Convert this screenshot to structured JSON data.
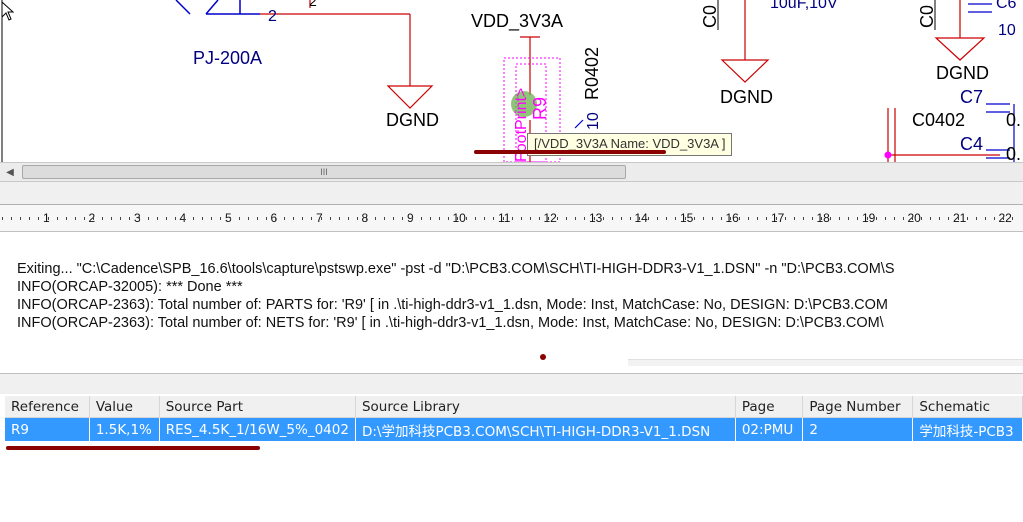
{
  "schematic": {
    "conn_pin": "2",
    "conn_pin_top": "2",
    "conn_part": "PJ-200A",
    "power_net": "VDD_3V3A",
    "gnd1": "DGND",
    "gnd2": "DGND",
    "gnd3": "DGND",
    "resistor_value": "R0402",
    "resistor_ref": "R9",
    "footprint_label": "FootPrint>",
    "pin10": "10",
    "cap_left": "C0",
    "cap_left_value": "10uF,10V",
    "cap_right": "C0",
    "cap_right_ref": "C6",
    "cap_right_value": "10",
    "c7": "C7",
    "c0402": "C0402",
    "c4": "C4",
    "c4_val": "0.",
    "c7_val": "0.",
    "tooltip": "[/VDD_3V3A Name: VDD_3V3A ]"
  },
  "scrollbar": {
    "grip": "III"
  },
  "ruler": {
    "labels": [
      "1",
      "2",
      "3",
      "4",
      "5",
      "6",
      "7",
      "8",
      "9",
      "10",
      "11",
      "12",
      "13",
      "14",
      "15",
      "16",
      "17",
      "18",
      "19",
      "20",
      "21",
      "22"
    ]
  },
  "session_log": [
    "Exiting... \"C:\\Cadence\\SPB_16.6\\tools\\capture\\pstswp.exe\" -pst -d \"D:\\PCB3.COM\\SCH\\TI-HIGH-DDR3-V1_1.DSN\" -n \"D:\\PCB3.COM\\S",
    "INFO(ORCAP-32005): *** Done ***",
    "INFO(ORCAP-2363): Total number of: PARTS for: 'R9' [ in .\\ti-high-ddr3-v1_1.dsn, Mode: Inst, MatchCase: No, DESIGN: D:\\PCB3.COM",
    "INFO(ORCAP-2363): Total number of: NETS for: 'R9' [ in .\\ti-high-ddr3-v1_1.dsn, Mode: Inst, MatchCase: No, DESIGN: D:\\PCB3.COM\\"
  ],
  "parts_table": {
    "columns": [
      "Reference",
      "Value",
      "Source Part",
      "Source Library",
      "Page",
      "Page Number",
      "Schematic"
    ],
    "rows": [
      [
        "R9",
        "1.5K,1%",
        "RES_4.5K_1/16W_5%_0402",
        "D:\\学加科技PCB3.COM\\SCH\\TI-HIGH-DDR3-V1_1.DSN",
        "02:PMU",
        "2",
        "学加科技-PCB3"
      ]
    ]
  },
  "colors": {
    "wire": "#cc0000",
    "net_text": "#000080",
    "footprint": "#ff00ff",
    "highlight_row": "#3399ff",
    "annotation": "#8b0000"
  }
}
